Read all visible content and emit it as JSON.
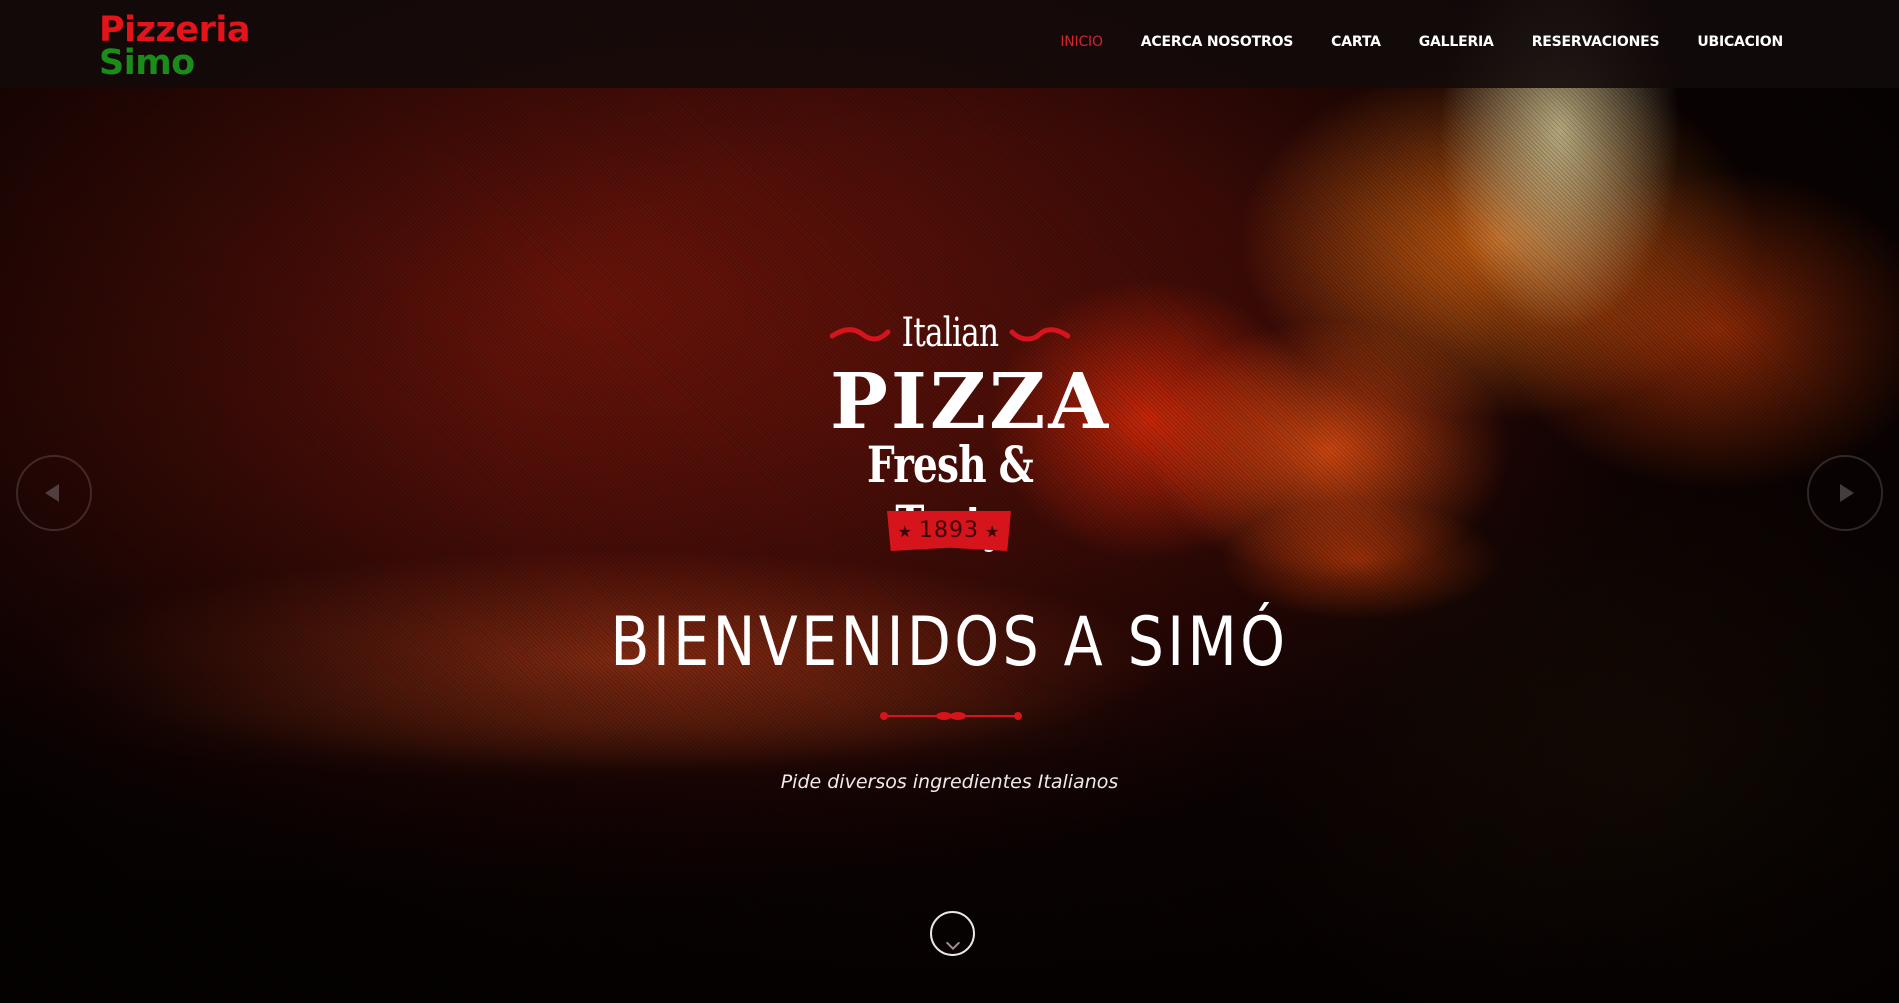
{
  "brand": {
    "line1": "Pizzeria",
    "line2": "Simo",
    "line1_color": "#e5141b",
    "line2_color": "#1a8c1a"
  },
  "nav": {
    "items": [
      {
        "label": "INICIO",
        "active": true
      },
      {
        "label": "ACERCA NOSOTROS",
        "active": false
      },
      {
        "label": "CARTA",
        "active": false
      },
      {
        "label": "GALLERIA",
        "active": false
      },
      {
        "label": "RESERVACIONES",
        "active": false
      },
      {
        "label": "UBICACION",
        "active": false
      }
    ],
    "active_color": "#d3232f"
  },
  "hero": {
    "badge": {
      "italian": "Italian",
      "pizza": "PIZZA",
      "fresh": "Fresh & Tasty",
      "year": "1893",
      "accent": "#d5141b"
    },
    "heading": "BIENVENIDOS A SIMÓ",
    "subtitle": "Pide diversos ingredientes Italianos",
    "prev_icon": "chevron-left-icon",
    "next_icon": "chevron-right-icon",
    "scroll_icon": "chevron-down-icon"
  }
}
